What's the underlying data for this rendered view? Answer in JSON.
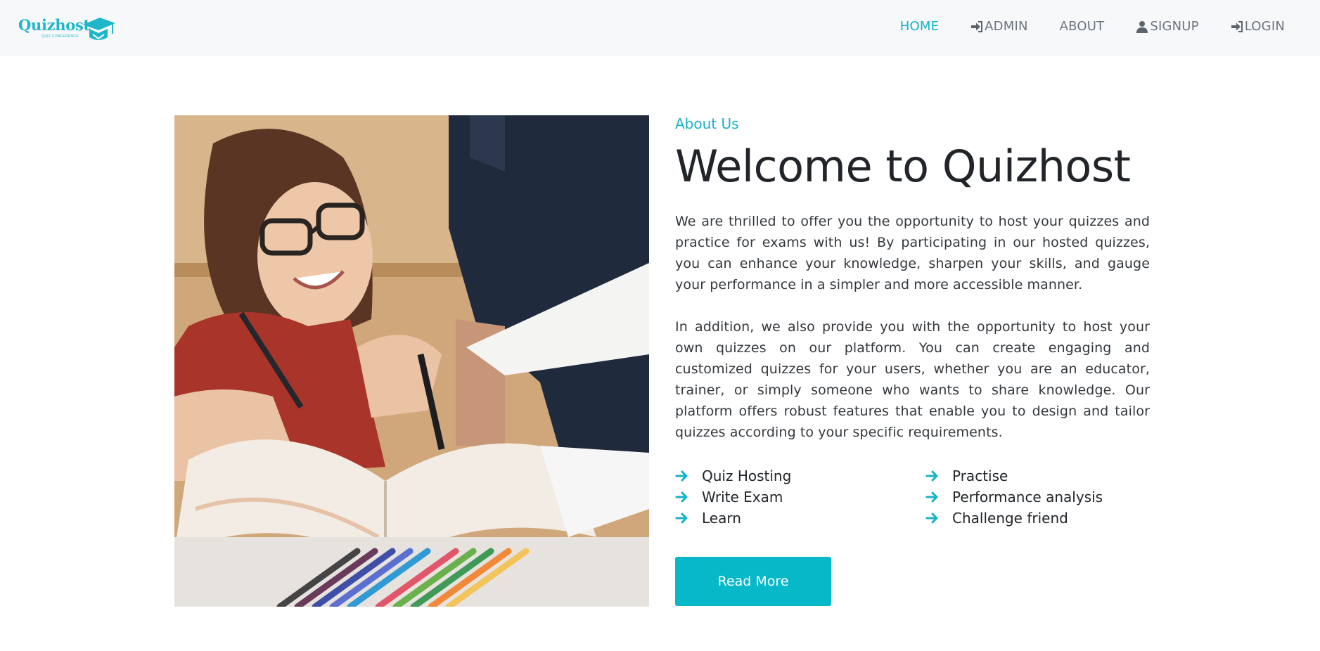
{
  "brand": {
    "name": "Quizhost",
    "tagline": "QUIZ CONFERENCE",
    "icon": "graduation-cap-icon",
    "color": "#1fb6c9"
  },
  "nav": {
    "items": [
      {
        "label": "HOME",
        "icon": null,
        "active": true
      },
      {
        "label": "ADMIN",
        "icon": "sign-in-icon",
        "active": false
      },
      {
        "label": "ABOUT",
        "icon": null,
        "active": false
      },
      {
        "label": "SIGNUP",
        "icon": "user-icon",
        "active": false
      },
      {
        "label": "LOGIN",
        "icon": "sign-in-icon",
        "active": false
      }
    ],
    "active_color": "#17b3c6"
  },
  "about": {
    "kicker": "About Us",
    "title": "Welcome to Quizhost",
    "paragraphs": [
      "We are thrilled to offer you the opportunity to host your quizzes and practice for exams with us! By participating in our hosted quizzes, you can enhance your knowledge, sharpen your skills, and gauge your performance in a simpler and more accessible manner.",
      "In addition, we also provide you with the opportunity to host your own quizzes on our platform. You can create engaging and customized quizzes for your users, whether you are an educator, trainer, or simply someone who wants to share knowledge. Our platform offers robust features that enable you to design and tailor quizzes according to your specific requirements."
    ],
    "features": [
      "Quiz Hosting",
      "Practise",
      "Write Exam",
      "Performance analysis",
      "Learn",
      "Challenge friend"
    ],
    "feature_icon": "arrow-right-icon",
    "button_label": "Read More",
    "accent": "#07b8c9"
  }
}
